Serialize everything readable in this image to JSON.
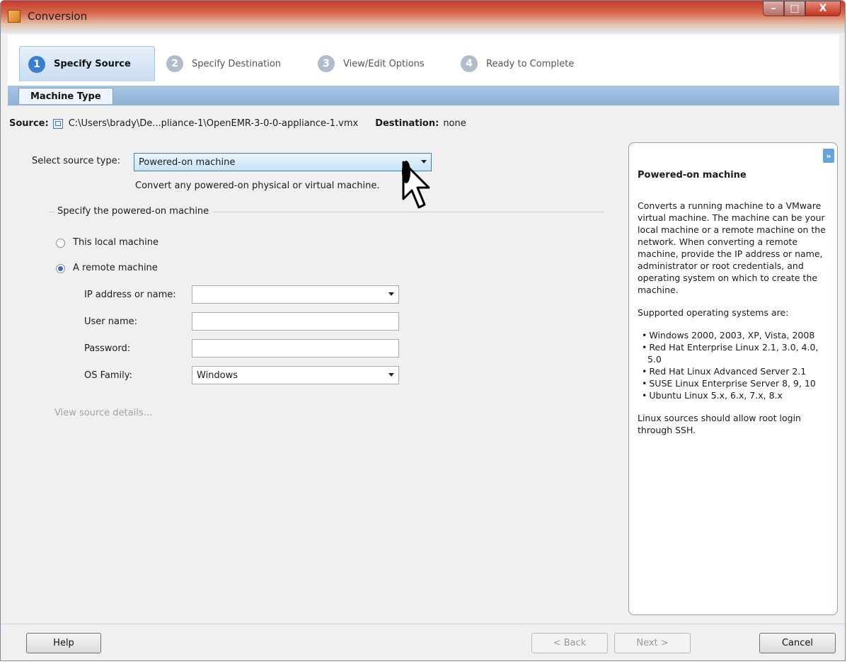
{
  "window": {
    "title": "Conversion",
    "controls": {
      "minimize": "–",
      "maximize": "□",
      "close": "X"
    }
  },
  "steps": [
    {
      "num": "1",
      "label": "Specify Source",
      "active": true
    },
    {
      "num": "2",
      "label": "Specify Destination"
    },
    {
      "num": "3",
      "label": "View/Edit Options"
    },
    {
      "num": "4",
      "label": "Ready to Complete"
    }
  ],
  "subtab": "Machine Type",
  "summary": {
    "source_label": "Source:",
    "source_path": "C:\\Users\\brady\\De...pliance-1\\OpenEMR-3-0-0-appliance-1.vmx",
    "destination_label": "Destination:",
    "destination_value": "none"
  },
  "form": {
    "source_type_label": "Select source type:",
    "source_type_value": "Powered-on machine",
    "source_type_hint": "Convert any powered-on physical or virtual machine.",
    "group_title": "Specify the powered-on machine",
    "radio_local": "This local machine",
    "radio_remote": "A remote machine",
    "ip_label": "IP address or name:",
    "ip_value": "",
    "user_label": "User name:",
    "user_value": "",
    "password_label": "Password:",
    "password_value": "",
    "os_label": "OS Family:",
    "os_value": "Windows",
    "view_details": "View source details..."
  },
  "help_panel": {
    "toggle": "»",
    "title": "Powered-on machine",
    "description": "Converts a running machine to a VMware virtual machine. The machine can be your local machine or a remote machine on the network. When converting a remote machine, provide the IP address or name, administrator or root credentials, and operating system on which to create the machine.",
    "supported_heading": "Supported operating systems are:",
    "os_list": [
      "Windows 2000, 2003, XP, Vista, 2008",
      "Red Hat Enterprise Linux 2.1, 3.0, 4.0, 5.0",
      "Red Hat Linux Advanced Server 2.1",
      "SUSE Linux Enterprise Server 8, 9, 10",
      "Ubuntu Linux 5.x, 6.x, 7.x, 8.x"
    ],
    "note": "Linux sources should allow root login through SSH."
  },
  "footer": {
    "help": "Help",
    "back": "< Back",
    "next": "Next >",
    "cancel": "Cancel"
  }
}
